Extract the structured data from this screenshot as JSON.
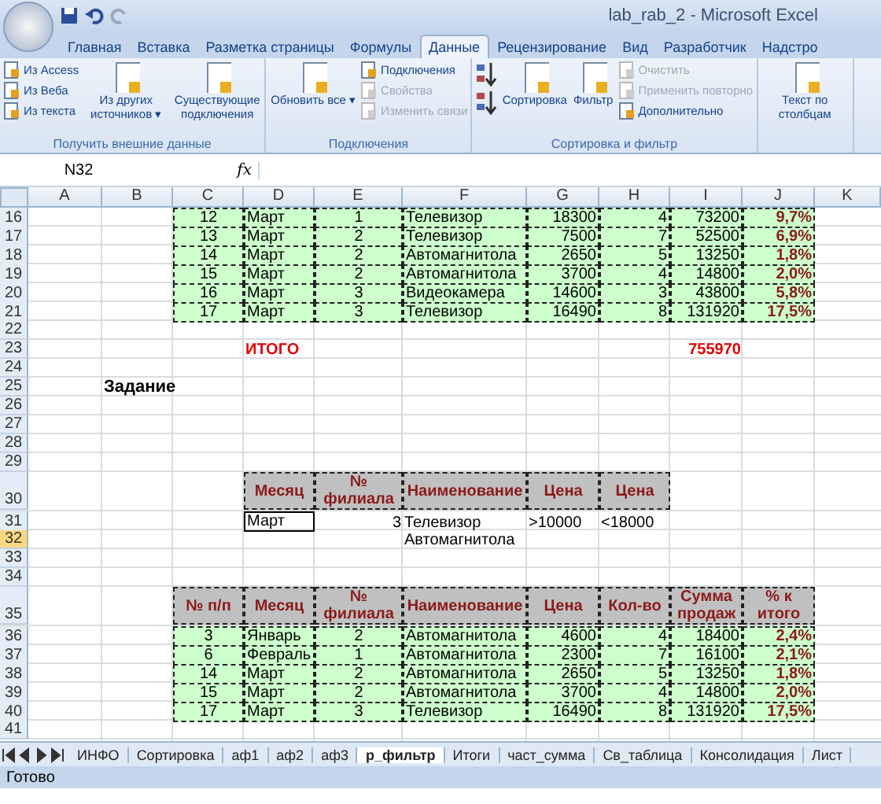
{
  "window": {
    "title": "lab_rab_2 - Microsoft Excel"
  },
  "ribbon_tabs": [
    {
      "label": "Главная",
      "selected": false
    },
    {
      "label": "Вставка",
      "selected": false
    },
    {
      "label": "Разметка страницы",
      "selected": false
    },
    {
      "label": "Формулы",
      "selected": false
    },
    {
      "label": "Данные",
      "selected": true
    },
    {
      "label": "Рецензирование",
      "selected": false
    },
    {
      "label": "Вид",
      "selected": false
    },
    {
      "label": "Разработчик",
      "selected": false
    },
    {
      "label": "Надстро",
      "selected": false
    }
  ],
  "groups": [
    {
      "label": "Получить внешние данные",
      "items": [
        {
          "kind": "stack",
          "items": [
            {
              "label": "Из Access",
              "disabled": false
            },
            {
              "label": "Из Веба",
              "disabled": false
            },
            {
              "label": "Из текста",
              "disabled": false
            }
          ]
        },
        {
          "kind": "large",
          "label": "Из других источников ▾",
          "disabled": false
        },
        {
          "kind": "large",
          "label": "Существующие подключения",
          "disabled": false
        }
      ]
    },
    {
      "label": "Подключения",
      "items": [
        {
          "kind": "large",
          "label": "Обновить все ▾",
          "disabled": false
        },
        {
          "kind": "stack",
          "items": [
            {
              "label": "Подключения",
              "disabled": false
            },
            {
              "label": "Свойства",
              "disabled": true
            },
            {
              "label": "Изменить связи",
              "disabled": true
            }
          ]
        }
      ]
    },
    {
      "label": "Сортировка и фильтр",
      "items": [
        {
          "kind": "sorticons"
        },
        {
          "kind": "large",
          "label": "Сортировка",
          "disabled": false
        },
        {
          "kind": "large",
          "label": "Фильтр",
          "disabled": false
        },
        {
          "kind": "stack",
          "items": [
            {
              "label": "Очистить",
              "disabled": true
            },
            {
              "label": "Применить повторно",
              "disabled": true
            },
            {
              "label": "Дополнительно",
              "disabled": false
            }
          ]
        }
      ]
    },
    {
      "items": [
        {
          "kind": "large",
          "label": "Текст по столбцам",
          "disabled": false
        }
      ]
    }
  ],
  "formula_bar": {
    "name_box": "N32",
    "fx": "fx"
  },
  "sheet": {
    "columns": [
      "A",
      "B",
      "C",
      "D",
      "E",
      "F",
      "G",
      "H",
      "I",
      "J",
      "K"
    ],
    "rows": [
      {
        "number": "16",
        "selected": false,
        "cells": [
          null,
          null,
          {
            "text": "12",
            "kind": "center"
          },
          {
            "text": "Март",
            "kind": "text"
          },
          {
            "text": "1",
            "kind": "center"
          },
          {
            "text": "Телевизор",
            "kind": "text"
          },
          {
            "text": "18300",
            "kind": "num"
          },
          {
            "text": "4",
            "kind": "num"
          },
          {
            "text": "73200",
            "kind": "num"
          },
          {
            "text": "9,7%",
            "kind": "pct"
          },
          null
        ]
      },
      {
        "number": "17",
        "selected": false,
        "cells": [
          null,
          null,
          {
            "text": "13",
            "kind": "center"
          },
          {
            "text": "Март",
            "kind": "text"
          },
          {
            "text": "2",
            "kind": "center"
          },
          {
            "text": "Телевизор",
            "kind": "text"
          },
          {
            "text": "7500",
            "kind": "num"
          },
          {
            "text": "7",
            "kind": "num"
          },
          {
            "text": "52500",
            "kind": "num"
          },
          {
            "text": "6,9%",
            "kind": "pct"
          },
          null
        ]
      },
      {
        "number": "18",
        "selected": false,
        "cells": [
          null,
          null,
          {
            "text": "14",
            "kind": "center"
          },
          {
            "text": "Март",
            "kind": "text"
          },
          {
            "text": "2",
            "kind": "center"
          },
          {
            "text": "Автомагнитола",
            "kind": "text"
          },
          {
            "text": "2650",
            "kind": "num"
          },
          {
            "text": "5",
            "kind": "num"
          },
          {
            "text": "13250",
            "kind": "num"
          },
          {
            "text": "1,8%",
            "kind": "pct"
          },
          null
        ]
      },
      {
        "number": "19",
        "selected": false,
        "cells": [
          null,
          null,
          {
            "text": "15",
            "kind": "center"
          },
          {
            "text": "Март",
            "kind": "text"
          },
          {
            "text": "2",
            "kind": "center"
          },
          {
            "text": "Автомагнитола",
            "kind": "text"
          },
          {
            "text": "3700",
            "kind": "num"
          },
          {
            "text": "4",
            "kind": "num"
          },
          {
            "text": "14800",
            "kind": "num"
          },
          {
            "text": "2,0%",
            "kind": "pct"
          },
          null
        ]
      },
      {
        "number": "20",
        "selected": false,
        "cells": [
          null,
          null,
          {
            "text": "16",
            "kind": "center"
          },
          {
            "text": "Март",
            "kind": "text"
          },
          {
            "text": "3",
            "kind": "center"
          },
          {
            "text": "Видеокамера",
            "kind": "text"
          },
          {
            "text": "14600",
            "kind": "num"
          },
          {
            "text": "3",
            "kind": "num"
          },
          {
            "text": "43800",
            "kind": "num"
          },
          {
            "text": "5,8%",
            "kind": "pct"
          },
          null
        ]
      },
      {
        "number": "21",
        "selected": false,
        "cells": [
          null,
          null,
          {
            "text": "17",
            "kind": "center"
          },
          {
            "text": "Март",
            "kind": "text"
          },
          {
            "text": "3",
            "kind": "center"
          },
          {
            "text": "Телевизор",
            "kind": "text"
          },
          {
            "text": "16490",
            "kind": "num"
          },
          {
            "text": "8",
            "kind": "num"
          },
          {
            "text": "131920",
            "kind": "num"
          },
          {
            "text": "17,5%",
            "kind": "pct"
          },
          null
        ]
      },
      {
        "number": "22",
        "selected": false
      },
      {
        "number": "23",
        "selected": false,
        "cells": [
          null,
          null,
          null,
          {
            "text": "ИТОГО",
            "kind": "total"
          },
          null,
          null,
          null,
          null,
          {
            "text": "755970",
            "kind": "total-num"
          },
          null,
          null
        ]
      },
      {
        "number": "24",
        "selected": false
      },
      {
        "number": "25",
        "selected": false,
        "cells": [
          null,
          {
            "text": "Задание",
            "kind": "title"
          },
          null,
          null,
          null,
          null,
          null,
          null,
          null,
          null,
          null
        ]
      },
      {
        "number": "26",
        "selected": false
      },
      {
        "number": "27",
        "selected": false
      },
      {
        "number": "28",
        "selected": false
      },
      {
        "number": "29",
        "selected": false
      },
      {
        "number": "30",
        "selected": false,
        "cells": [
          null,
          null,
          null,
          {
            "text": "Месяц",
            "kind": "head"
          },
          {
            "text": "№ филиала",
            "kind": "head"
          },
          {
            "text": "Наименование",
            "kind": "head"
          },
          {
            "text": "Цена",
            "kind": "head"
          },
          {
            "text": "Цена",
            "kind": "head"
          },
          null,
          null,
          null
        ]
      },
      {
        "number": "31",
        "selected": false,
        "cells": [
          null,
          null,
          null,
          {
            "text": "Март",
            "kind": "crit"
          },
          {
            "text": "3",
            "kind": "plain-num"
          },
          {
            "text": "Телевизор",
            "kind": "plain"
          },
          {
            "text": ">10000",
            "kind": "plain"
          },
          {
            "text": "<18000",
            "kind": "plain"
          },
          null,
          null,
          null
        ]
      },
      {
        "number": "32",
        "selected": true,
        "cells": [
          null,
          null,
          null,
          null,
          null,
          {
            "text": "Автомагнитола",
            "kind": "plain"
          },
          null,
          null,
          null,
          null,
          null
        ]
      },
      {
        "number": "33",
        "selected": false
      },
      {
        "number": "34",
        "selected": false
      },
      {
        "number": "35",
        "selected": false,
        "cells": [
          null,
          null,
          {
            "text": "№ п/п",
            "kind": "head"
          },
          {
            "text": "Месяц",
            "kind": "head"
          },
          {
            "text": "№ филиала",
            "kind": "head"
          },
          {
            "text": "Наименование",
            "kind": "head"
          },
          {
            "text": "Цена",
            "kind": "head"
          },
          {
            "text": "Кол-во",
            "kind": "head"
          },
          {
            "text": "Сумма продаж",
            "kind": "head"
          },
          {
            "text": "% к итого",
            "kind": "head"
          },
          null
        ]
      },
      {
        "number": "36",
        "selected": false,
        "cells": [
          null,
          null,
          {
            "text": "3",
            "kind": "center"
          },
          {
            "text": "Январь",
            "kind": "text"
          },
          {
            "text": "2",
            "kind": "center"
          },
          {
            "text": "Автомагнитола",
            "kind": "text"
          },
          {
            "text": "4600",
            "kind": "num"
          },
          {
            "text": "4",
            "kind": "num"
          },
          {
            "text": "18400",
            "kind": "num"
          },
          {
            "text": "2,4%",
            "kind": "pct"
          },
          null
        ]
      },
      {
        "number": "37",
        "selected": false,
        "cells": [
          null,
          null,
          {
            "text": "6",
            "kind": "center"
          },
          {
            "text": "Февраль",
            "kind": "text"
          },
          {
            "text": "1",
            "kind": "center"
          },
          {
            "text": "Автомагнитола",
            "kind": "text"
          },
          {
            "text": "2300",
            "kind": "num"
          },
          {
            "text": "7",
            "kind": "num"
          },
          {
            "text": "16100",
            "kind": "num"
          },
          {
            "text": "2,1%",
            "kind": "pct"
          },
          null
        ]
      },
      {
        "number": "38",
        "selected": false,
        "cells": [
          null,
          null,
          {
            "text": "14",
            "kind": "center"
          },
          {
            "text": "Март",
            "kind": "text"
          },
          {
            "text": "2",
            "kind": "center"
          },
          {
            "text": "Автомагнитола",
            "kind": "text"
          },
          {
            "text": "2650",
            "kind": "num"
          },
          {
            "text": "5",
            "kind": "num"
          },
          {
            "text": "13250",
            "kind": "num"
          },
          {
            "text": "1,8%",
            "kind": "pct"
          },
          null
        ]
      },
      {
        "number": "39",
        "selected": false,
        "cells": [
          null,
          null,
          {
            "text": "15",
            "kind": "center"
          },
          {
            "text": "Март",
            "kind": "text"
          },
          {
            "text": "2",
            "kind": "center"
          },
          {
            "text": "Автомагнитола",
            "kind": "text"
          },
          {
            "text": "3700",
            "kind": "num"
          },
          {
            "text": "4",
            "kind": "num"
          },
          {
            "text": "14800",
            "kind": "num"
          },
          {
            "text": "2,0%",
            "kind": "pct"
          },
          null
        ]
      },
      {
        "number": "40",
        "selected": false,
        "cells": [
          null,
          null,
          {
            "text": "17",
            "kind": "center"
          },
          {
            "text": "Март",
            "kind": "text"
          },
          {
            "text": "3",
            "kind": "center"
          },
          {
            "text": "Телевизор",
            "kind": "text"
          },
          {
            "text": "16490",
            "kind": "num"
          },
          {
            "text": "8",
            "kind": "num"
          },
          {
            "text": "131920",
            "kind": "num"
          },
          {
            "text": "17,5%",
            "kind": "pct"
          },
          null
        ]
      },
      {
        "number": "41",
        "selected": false
      }
    ]
  },
  "sheet_tabs": [
    {
      "label": "ИНФО",
      "selected": false
    },
    {
      "label": "Сортировка",
      "selected": false
    },
    {
      "label": "аф1",
      "selected": false
    },
    {
      "label": "аф2",
      "selected": false
    },
    {
      "label": "аф3",
      "selected": false
    },
    {
      "label": "р_фильтр",
      "selected": true
    },
    {
      "label": "Итоги",
      "selected": false
    },
    {
      "label": "част_сумма",
      "selected": false
    },
    {
      "label": "Св_таблица",
      "selected": false
    },
    {
      "label": "Консолидация",
      "selected": false
    },
    {
      "label": "Лист",
      "selected": false
    }
  ],
  "status_bar": {
    "text": "Готово"
  }
}
